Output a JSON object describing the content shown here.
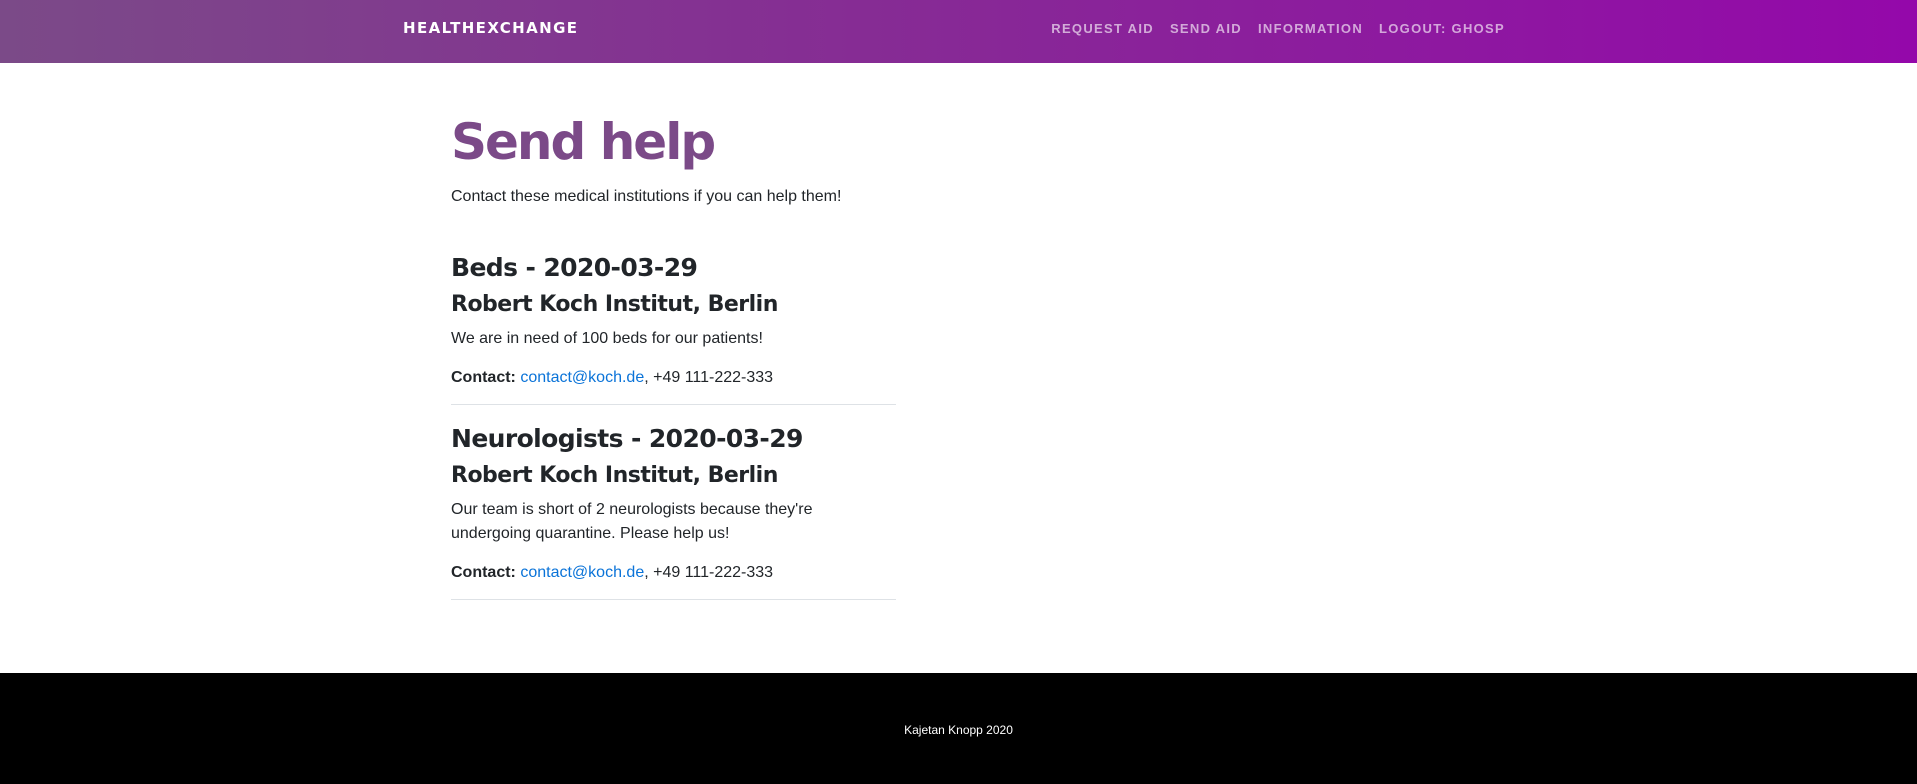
{
  "navbar": {
    "brand": "HEALTHEXCHANGE",
    "links": [
      "REQUEST AID",
      "SEND AID",
      "INFORMATION",
      "LOGOUT: GHOSP"
    ]
  },
  "main": {
    "title": "Send help",
    "lead": "Contact these medical institutions if you can help them!",
    "entries": [
      {
        "title": "Beds - 2020-03-29",
        "org": "Robert Koch Institut, Berlin",
        "description": "We are in need of 100 beds for our patients!",
        "contact_label": "Contact:",
        "email": "contact@koch.de",
        "phone": ", +49 111-222-333"
      },
      {
        "title": "Neurologists - 2020-03-29",
        "org": "Robert Koch Institut, Berlin",
        "description": "Our team is short of 2 neurologists because they're undergoing quarantine. Please help us!",
        "contact_label": "Contact:",
        "email": "contact@koch.de",
        "phone": ", +49 111-222-333"
      }
    ]
  },
  "footer": {
    "text": "Kajetan Knopp 2020"
  },
  "colors": {
    "accent": "#7b4a88",
    "navbar_end": "#9408aa",
    "link": "#0a73d8",
    "footer_bg": "#000000"
  }
}
